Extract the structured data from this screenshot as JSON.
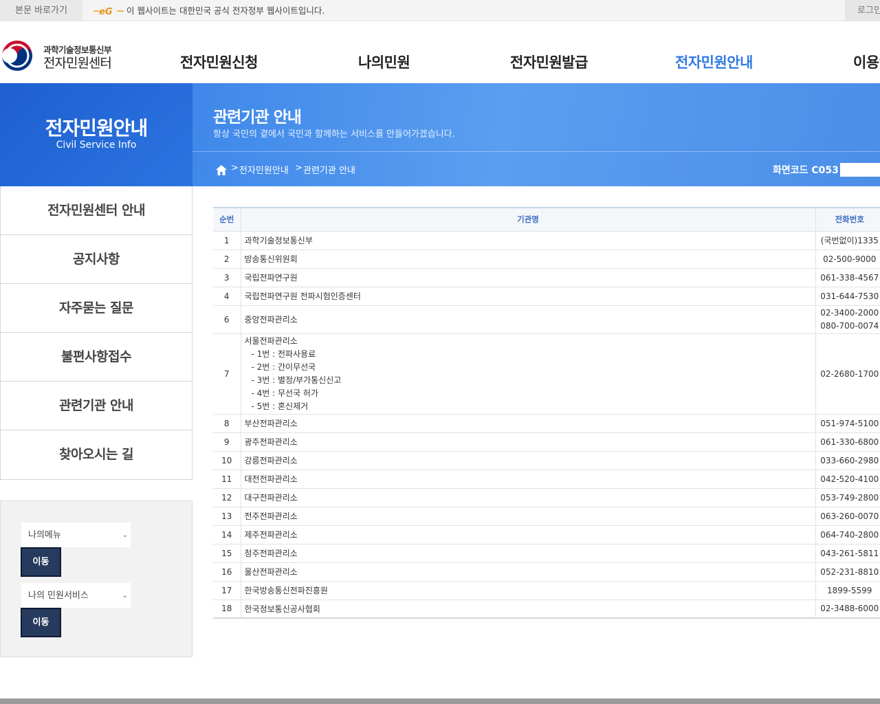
{
  "topbar": {
    "skip_link": "본문 바로가기",
    "egov_logo": "eG",
    "notice": "이 웹사이트는 대한민국 공식 전자정부 웹사이트입니다.",
    "login": "로그인"
  },
  "header": {
    "ministry": "과학기술정보통신부",
    "center": "전자민원센터",
    "nav": [
      {
        "label": "전자민원신청"
      },
      {
        "label": "나의민원"
      },
      {
        "label": "전자민원발급"
      },
      {
        "label": "전자민원안내",
        "active": true
      },
      {
        "label": "이용안내"
      }
    ]
  },
  "banner": {
    "section_title": "전자민원안내",
    "section_subtitle": "Civil Service Info",
    "page_title": "관련기관 안내",
    "page_subtitle": "항상 국민의 곁에서 국민과 함께하는 서비스를 만들어가겠습니다.",
    "breadcrumb": [
      "전자민원안내",
      "관련기관 안내"
    ],
    "breadcrumb_sep": ">",
    "screen_code": "화면코드 C053"
  },
  "sidebar": {
    "items": [
      {
        "label": "전자민원센터 안내"
      },
      {
        "label": "공지사항"
      },
      {
        "label": "자주묻는 질문"
      },
      {
        "label": "불편사항접수"
      },
      {
        "label": "관련기관 안내"
      },
      {
        "label": "찾아오시는 길"
      }
    ],
    "quick": {
      "select1": "나의메뉴",
      "select2": "나의 민원서비스",
      "go_label": "이동"
    }
  },
  "table": {
    "headers": {
      "no": "순번",
      "name": "기관명",
      "tel": "전화번호"
    },
    "rows": [
      {
        "no": "1",
        "name": "과학기술정보통신부",
        "tel": "(국번없이)1335"
      },
      {
        "no": "2",
        "name": "방송통신위원회",
        "tel": "02-500-9000"
      },
      {
        "no": "3",
        "name": "국립전파연구원",
        "tel": "061-338-4567"
      },
      {
        "no": "4",
        "name": "국립전파연구원 전파시험인증센터",
        "tel": "031-644-7530"
      },
      {
        "no": "6",
        "name": "중앙전파관리소",
        "tel": "02-3400-2000",
        "tel2": "080-700-0074"
      },
      {
        "no": "7",
        "name": "서울전파관리소",
        "tel": "02-2680-1700",
        "sublines": [
          "- 1번 : 전파사용료",
          "- 2번 : 간이무선국",
          "- 3번 : 별정/부가통신신고",
          "- 4번 : 무선국 허가",
          "- 5번 : 혼신제거"
        ]
      },
      {
        "no": "8",
        "name": "부산전파관리소",
        "tel": "051-974-5100"
      },
      {
        "no": "9",
        "name": "광주전파관리소",
        "tel": "061-330-6800"
      },
      {
        "no": "10",
        "name": "강릉전파관리소",
        "tel": "033-660-2980"
      },
      {
        "no": "11",
        "name": "대전전파관리소",
        "tel": "042-520-4100"
      },
      {
        "no": "12",
        "name": "대구전파관리소",
        "tel": "053-749-2800"
      },
      {
        "no": "13",
        "name": "전주전파관리소",
        "tel": "063-260-0070"
      },
      {
        "no": "14",
        "name": "제주전파관리소",
        "tel": "064-740-2800"
      },
      {
        "no": "15",
        "name": "청주전파관리소",
        "tel": "043-261-5811"
      },
      {
        "no": "16",
        "name": "울산전파관리소",
        "tel": "052-231-8810"
      },
      {
        "no": "17",
        "name": "한국방송통신전파진흥원",
        "tel": "1899-5599"
      },
      {
        "no": "18",
        "name": "한국정보통신공사협회",
        "tel": "02-3488-6000"
      }
    ]
  },
  "colors": {
    "accent": "#2f7ae5",
    "banner_dark": "#1e5fd0",
    "button": "#273b5e"
  },
  "icons": [
    "taegeuk-emblem-icon",
    "home-icon",
    "chevron-down-icon"
  ]
}
